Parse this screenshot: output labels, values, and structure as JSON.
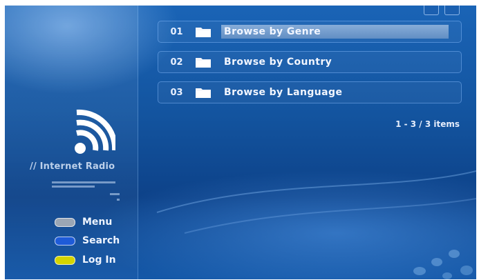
{
  "sidebar": {
    "title": "// Internet Radio",
    "legend": [
      {
        "label": "Menu",
        "color": "#9aa6b5"
      },
      {
        "label": "Search",
        "color": "#1e5bd8"
      },
      {
        "label": "Log In",
        "color": "#d4d400"
      }
    ]
  },
  "list": {
    "items": [
      {
        "number": "01",
        "label": "Browse by Genre",
        "icon": "folder-icon",
        "selected": true
      },
      {
        "number": "02",
        "label": "Browse by Country",
        "icon": "folder-icon",
        "selected": false
      },
      {
        "number": "03",
        "label": "Browse by Language",
        "icon": "folder-icon",
        "selected": false
      }
    ],
    "count": "1 - 3 / 3 items"
  },
  "colors": {
    "background": "#13549f",
    "selection": "#a8bfdc",
    "text": "#f2f6ff"
  }
}
